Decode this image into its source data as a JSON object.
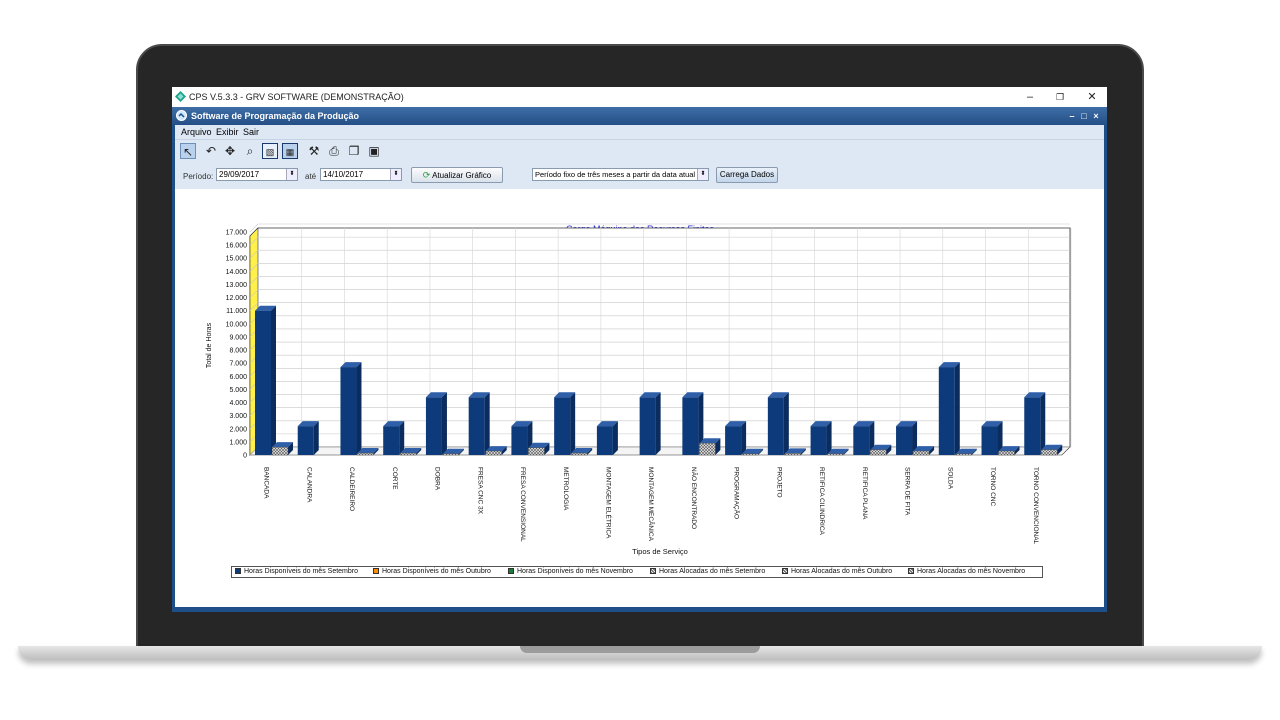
{
  "os_window": {
    "title": "CPS V.5.3.3 - GRV SOFTWARE (DEMONSTRAÇÃO)",
    "minimize": "–",
    "restore": "❐",
    "close": "✕"
  },
  "app": {
    "title": "Software de Programação da Produção",
    "mdi_min": "–",
    "mdi_max": "□",
    "mdi_close": "×"
  },
  "menu": [
    "Arquivo",
    "Exibir",
    "Sair"
  ],
  "toolbar_icons": [
    "cursor-icon",
    "undo-icon",
    "move-icon",
    "zoom-icon",
    "image-icon",
    "chart-icon",
    "tools-icon",
    "print-icon",
    "copy-icon",
    "save-icon"
  ],
  "params": {
    "period_label": "Período:",
    "start_date": "29/09/2017",
    "until_label": "até",
    "end_date": "14/10/2017",
    "refresh_button": "Atualizar Gráfico",
    "period_option": "Período fixo de três meses a partir da data atual",
    "load_button": "Carrega Dados"
  },
  "colors": {
    "bar_september": "#0d3a7a",
    "bar_october": "#ff8c00",
    "bar_november": "#1e7a3a",
    "back_wall_accent": "#fff04a"
  },
  "chart_data": {
    "type": "bar",
    "title": "Carga Máquina dos Recursos Finitos",
    "xlabel": "Tipos de Serviço",
    "ylabel": "Total de Horas",
    "ylim": [
      0,
      17000
    ],
    "yticks": [
      "0",
      "1.000",
      "2.000",
      "3.000",
      "4.000",
      "5.000",
      "6.000",
      "7.000",
      "8.000",
      "9.000",
      "10.000",
      "11.000",
      "12.000",
      "13.000",
      "14.000",
      "15.000",
      "16.000",
      "17.000"
    ],
    "grid": true,
    "legend_position": "bottom",
    "categories": [
      "BANCADA",
      "CALANDRA",
      "CALDEIREIRO",
      "CORTE",
      "DOBRA",
      "FRESA CNC 3X",
      "FRESA CONVENSIONAL",
      "METROLOGIA",
      "MONTAGEM ELÉTRICA",
      "MONTAGEM MECÂNICA",
      "NÃO ENCONTRADO",
      "PROGRAMAÇÃO",
      "PROJETO",
      "RETIFICA CILINDRICA",
      "RETIFICA PLANA",
      "SERRA DE FITA",
      "SOLDA",
      "TORNO CNC",
      "TORNO CONVENCIONAL"
    ],
    "series": [
      {
        "name": "Horas Disponíveis do mês Setembro",
        "values": [
          11000,
          2200,
          6700,
          2200,
          4400,
          4400,
          2200,
          4400,
          2200,
          4400,
          4400,
          2200,
          4400,
          2200,
          2200,
          2200,
          6700,
          2200,
          4400
        ]
      },
      {
        "name": "Horas Disponíveis do mês Outubro",
        "values": [
          0,
          0,
          0,
          0,
          0,
          0,
          0,
          0,
          0,
          0,
          0,
          0,
          0,
          0,
          0,
          0,
          0,
          0,
          0
        ]
      },
      {
        "name": "Horas Disponíveis do mês Novembro",
        "values": [
          0,
          0,
          0,
          0,
          0,
          0,
          0,
          0,
          0,
          0,
          0,
          0,
          0,
          0,
          0,
          0,
          0,
          0,
          0
        ]
      },
      {
        "name": "Horas Alocadas do mês Setembro",
        "values": [
          600,
          0,
          150,
          150,
          100,
          300,
          550,
          150,
          0,
          0,
          900,
          100,
          120,
          100,
          400,
          300,
          100,
          300,
          400
        ]
      },
      {
        "name": "Horas Alocadas do mês Outubro",
        "values": [
          0,
          0,
          0,
          0,
          0,
          0,
          0,
          0,
          0,
          0,
          0,
          0,
          0,
          0,
          0,
          0,
          0,
          0,
          0
        ]
      },
      {
        "name": "Horas Alocadas do mês Novembro",
        "values": [
          0,
          0,
          0,
          0,
          0,
          0,
          0,
          0,
          0,
          0,
          0,
          0,
          0,
          0,
          0,
          0,
          0,
          0,
          0
        ]
      }
    ]
  }
}
